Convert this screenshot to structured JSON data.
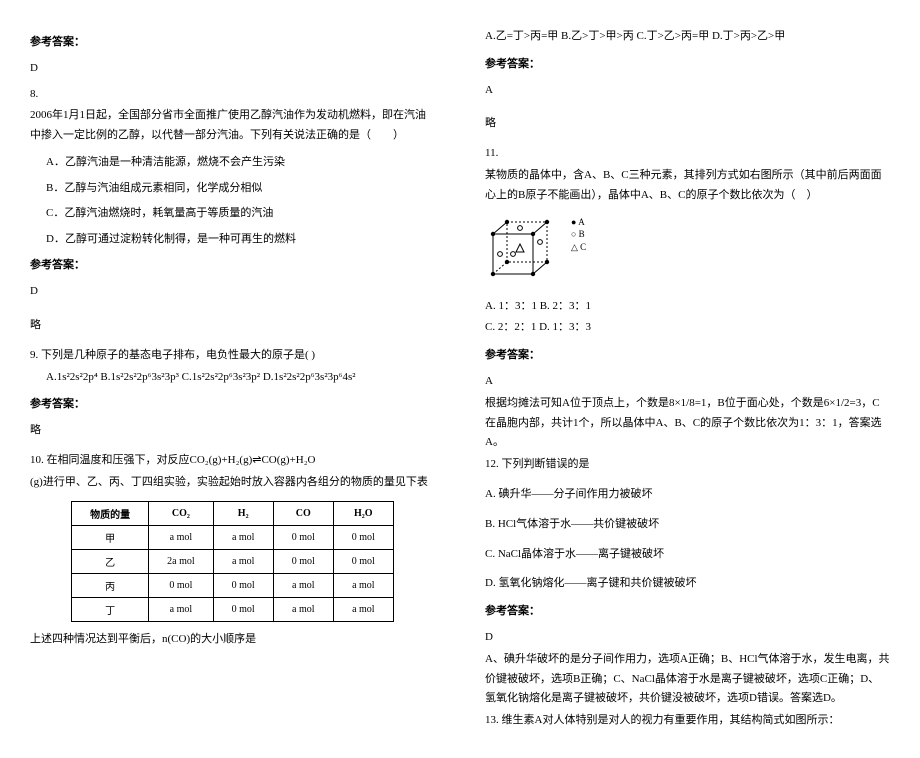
{
  "left": {
    "ref_label_1": "参考答案：",
    "ans_7": "D",
    "q8_num": "8.",
    "q8_text_1": "2006年1月1日起，全国部分省市全面推广使用乙醇汽油作为发动机燃料，即在汽油中掺入一定比例的乙醇，以代替一部分汽油。下列有关说法正确的是（　　）",
    "q8_opt_a": "A．乙醇汽油是一种清洁能源，燃烧不会产生污染",
    "q8_opt_b": "B．乙醇与汽油组成元素相同，化学成分相似",
    "q8_opt_c": "C．乙醇汽油燃烧时，耗氧量高于等质量的汽油",
    "q8_opt_d": "D．乙醇可通过淀粉转化制得，是一种可再生的燃料",
    "ref_label_2": "参考答案：",
    "ans_8": "D",
    "ans_8_note": "略",
    "q9_text": "9. 下列是几种原子的基态电子排布，电负性最大的原子是(    )",
    "q9_opts": "A.1s²2s²2p⁴    B.1s²2s²2p⁶3s²3p³    C.1s²2s²2p⁶3s²3p²    D.1s²2s²2p⁶3s²3p⁶4s²",
    "ref_label_3": "参考答案：",
    "ans_9": "略",
    "q10_text_1": "10. 在相同温度和压强下，对反应CO₂(g)+H₂(g)⇌CO(g)+H₂O",
    "q10_text_2": "(g)进行甲、乙、丙、丁四组实验，实验起始时放入容器内各组分的物质的量见下表",
    "table": {
      "h0": "物质的量",
      "h1": "CO₂",
      "h2": "H₂",
      "h3": "CO",
      "h4": "H₂O",
      "r1c0": "甲",
      "r1c1": "a mol",
      "r1c2": "a mol",
      "r1c3": "0 mol",
      "r1c4": "0 mol",
      "r2c0": "乙",
      "r2c1": "2a mol",
      "r2c2": "a mol",
      "r2c3": "0 mol",
      "r2c4": "0 mol",
      "r3c0": "丙",
      "r3c1": "0 mol",
      "r3c2": "0 mol",
      "r3c3": "a mol",
      "r3c4": "a mol",
      "r4c0": "丁",
      "r4c1": "a mol",
      "r4c2": "0 mol",
      "r4c3": "a mol",
      "r4c4": "a mol"
    },
    "q10_text_3": "上述四种情况达到平衡后，n(CO)的大小顺序是"
  },
  "right": {
    "q10_opts": "A.乙=丁>丙=甲   B.乙>丁>甲>丙   C.丁>乙>丙=甲  D.丁>丙>乙>甲",
    "ref_label_4": "参考答案：",
    "ans_10": "A",
    "ans_10_note": "略",
    "q11_num": "11.",
    "q11_text_1": "某物质的晶体中，含A、B、C三种元素，其排列方式如右图所示（其中前后两面面心上的B原子不能画出），晶体中A、B、C的原子个数比依次为（　）",
    "legend_a": "● A",
    "legend_b": "○ B",
    "legend_c": "△ C",
    "q11_opt_line1": "A. 1：3：1    B. 2：3：1",
    "q11_opt_line2": "C. 2：2：1    D. 1：3：3",
    "ref_label_5": "参考答案：",
    "ans_11": "A",
    "ans_11_exp": "根据均摊法可知A位于顶点上，个数是8×1/8=1，B位于面心处，个数是6×1/2=3，C在晶胞内部，共计1个，所以晶体中A、B、C的原子个数比依次为1：3：1，答案选A。",
    "q12_text": "12. 下列判断错误的是",
    "q12_opt_a": "A. 碘升华——分子间作用力被破坏",
    "q12_opt_b": "B. HCl气体溶于水——共价键被破坏",
    "q12_opt_c": "C. NaCl晶体溶于水——离子键被破坏",
    "q12_opt_d": "D. 氢氧化钠熔化——离子键和共价键被破坏",
    "ref_label_6": "参考答案：",
    "ans_12": "D",
    "ans_12_exp": "A、碘升华破坏的是分子间作用力，选项A正确；B、HCl气体溶于水，发生电离，共价键被破坏，选项B正确；C、NaCl晶体溶于水是离子键被破坏，选项C正确；D、氢氧化钠熔化是离子键被破坏，共价键没被破坏，选项D错误。答案选D。",
    "q13_text": "13. 维生素A对人体特别是对人的视力有重要作用，其结构简式如图所示："
  }
}
